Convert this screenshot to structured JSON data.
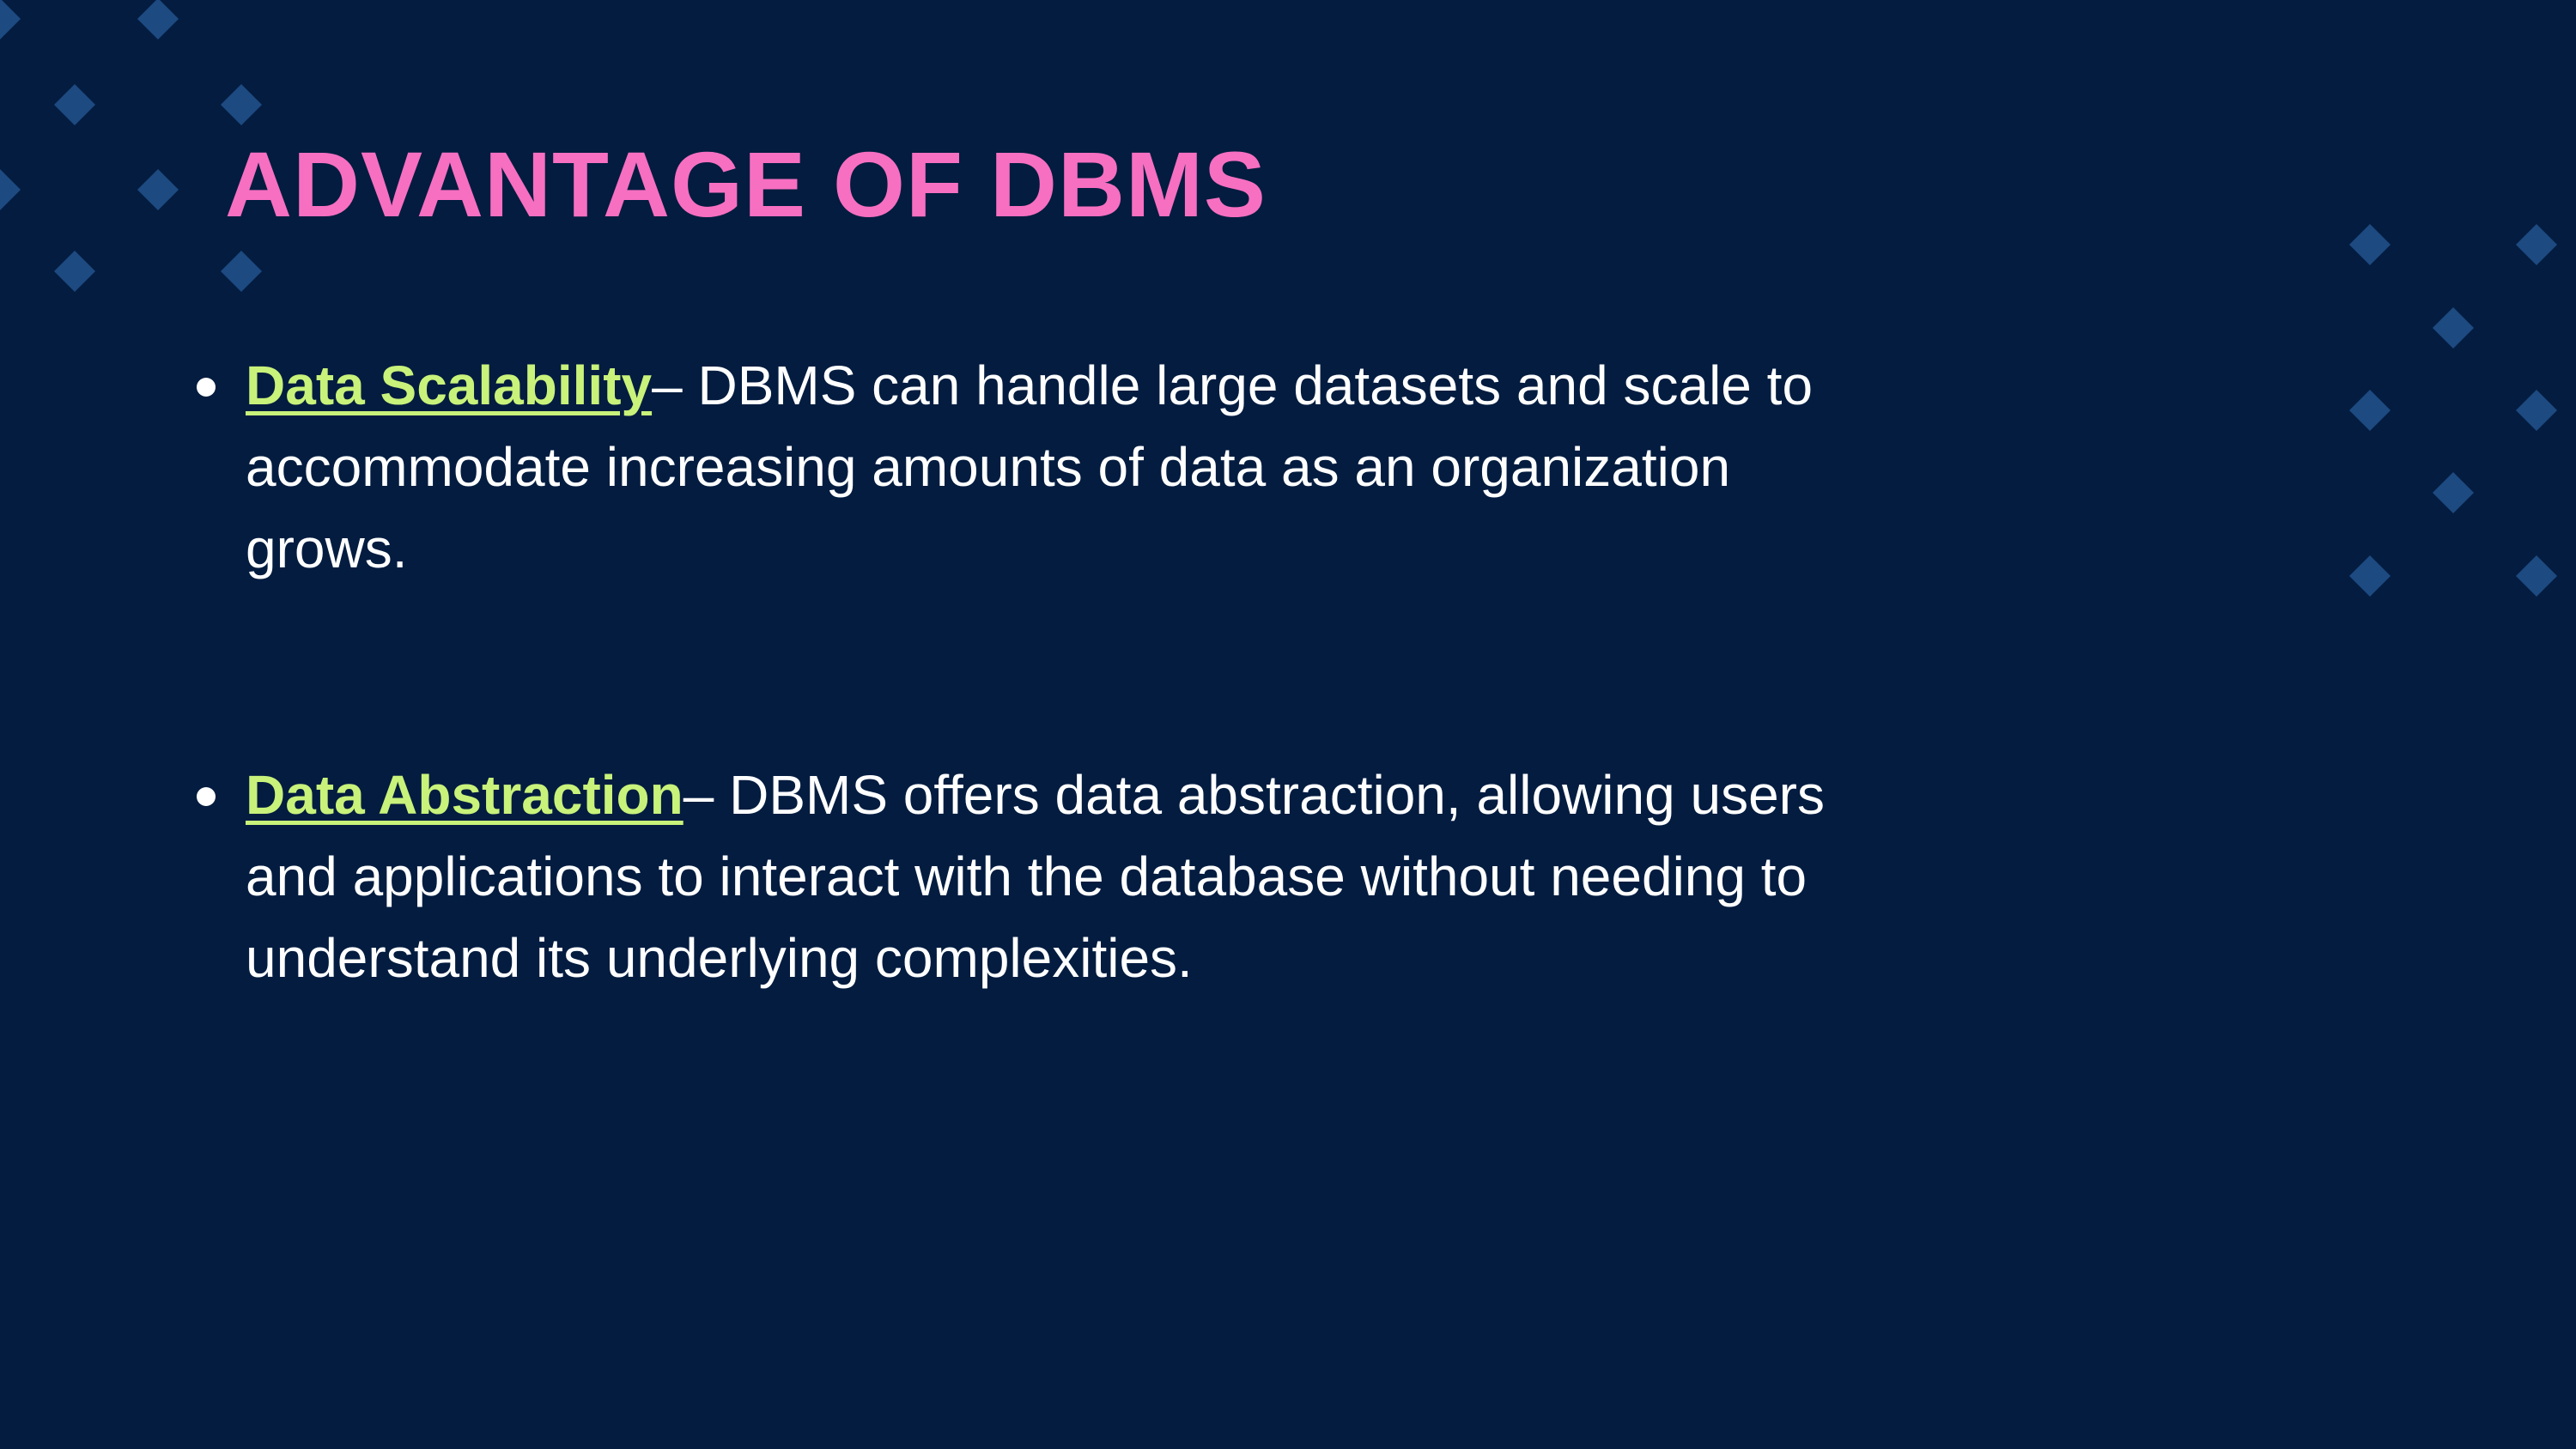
{
  "slide": {
    "title": "ADVANTAGE OF DBMS",
    "bullets": [
      {
        "term": "Data Scalability",
        "description": "– DBMS can handle large datasets and scale to accommodate increasing amounts of data as an organization grows."
      },
      {
        "term": "Data Abstraction",
        "description": "– DBMS offers data abstraction, allowing users and applications to interact with the database without needing to understand its underlying complexities."
      }
    ]
  },
  "colors": {
    "background": "#031c40",
    "title": "#f76fc1",
    "term": "#c8f27a",
    "body_text": "#ffffff",
    "decoration": "#1d4a80"
  },
  "decoration": {
    "shape": "diamond-icon"
  }
}
